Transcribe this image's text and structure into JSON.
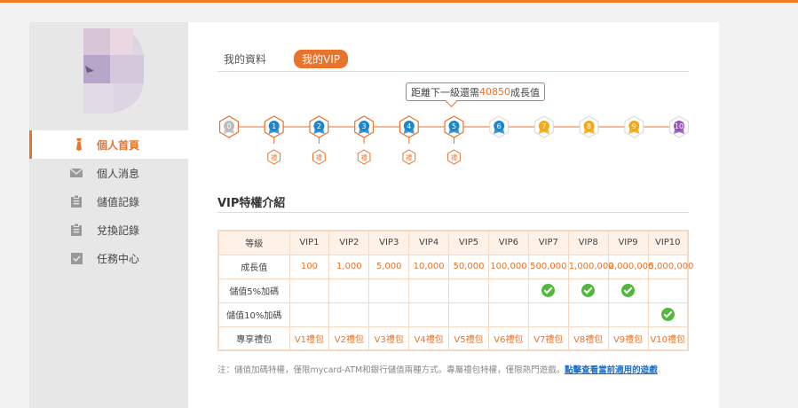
{
  "sidebar": {
    "menu": [
      {
        "label": "個人首頁",
        "icon": "tie-icon",
        "active": true
      },
      {
        "label": "個人消息",
        "icon": "envelope-icon",
        "active": false
      },
      {
        "label": "儲值記錄",
        "icon": "clipboard-icon",
        "active": false
      },
      {
        "label": "兌換記錄",
        "icon": "clipboard-icon",
        "active": false
      },
      {
        "label": "任務中心",
        "icon": "checkbox-icon",
        "active": false
      }
    ]
  },
  "tabs": [
    {
      "label": "我的資料",
      "active": false
    },
    {
      "label": "我的VIP",
      "active": true
    }
  ],
  "progress": {
    "prefix": "距離下一級還需",
    "value": "40850",
    "suffix": "成長值"
  },
  "levels": [
    {
      "label": "0",
      "gift": false
    },
    {
      "label": "1",
      "gift": true
    },
    {
      "label": "2",
      "gift": true
    },
    {
      "label": "3",
      "gift": true
    },
    {
      "label": "4",
      "gift": true
    },
    {
      "label": "5",
      "gift": true
    },
    {
      "label": "6",
      "gift": false
    },
    {
      "label": "7",
      "gift": false
    },
    {
      "label": "8",
      "gift": false
    },
    {
      "label": "9",
      "gift": false
    },
    {
      "label": "10",
      "gift": false
    }
  ],
  "gift_badge_text": "禮",
  "colors": {
    "accent": "#e8732a",
    "reached": "#e8732a",
    "blue": "#1f87c9",
    "gold": "#f2a916",
    "purple": "#9b4fc4",
    "check": "#52b83b"
  },
  "section_title": "VIP特權介紹",
  "table": {
    "headers": [
      "等級",
      "VIP1",
      "VIP2",
      "VIP3",
      "VIP4",
      "VIP5",
      "VIP6",
      "VIP7",
      "VIP8",
      "VIP9",
      "VIP10"
    ],
    "growth_label": "成長值",
    "growth": [
      "100",
      "1,000",
      "5,000",
      "10,000",
      "50,000",
      "100,000",
      "500,000",
      "1,000,000",
      "2,000,000",
      "5,000,000"
    ],
    "bonus5_label": "儲值5%加碼",
    "bonus5": [
      false,
      false,
      false,
      false,
      false,
      false,
      true,
      true,
      true,
      false
    ],
    "bonus10_label": "儲值10%加碼",
    "bonus10": [
      false,
      false,
      false,
      false,
      false,
      false,
      false,
      false,
      false,
      true
    ],
    "package_label": "專享禮包",
    "packages": [
      "V1禮包",
      "V2禮包",
      "V3禮包",
      "V4禮包",
      "V5禮包",
      "V6禮包",
      "V7禮包",
      "V8禮包",
      "V9禮包",
      "V10禮包"
    ]
  },
  "note": {
    "text": "注：儲值加碼特權，僅限mycard-ATM和銀行儲值兩種方式。專屬禮包特權，僅限熱門遊戲。",
    "link": "點擊查看當前適用的遊戲"
  }
}
